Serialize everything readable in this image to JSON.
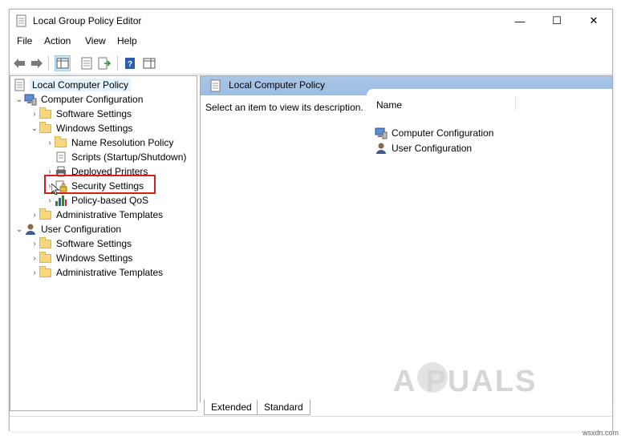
{
  "window": {
    "title": "Local Group Policy Editor",
    "controls": {
      "minimize": "—",
      "maximize": "☐",
      "close": "✕"
    }
  },
  "menu": {
    "items": [
      "File",
      "Action",
      "View",
      "Help"
    ]
  },
  "toolbar": {
    "buttons": [
      "back-arrow-icon",
      "forward-arrow-icon",
      "show-hide-tree-icon",
      "properties-icon",
      "export-list-icon",
      "help-icon",
      "show-hide-action-pane-icon"
    ]
  },
  "tree": {
    "root": "Local Computer Policy",
    "computer_config": "Computer Configuration",
    "cc_software": "Software Settings",
    "cc_windows": "Windows Settings",
    "name_resolution": "Name Resolution Policy",
    "scripts": "Scripts (Startup/Shutdown)",
    "deployed_printers": "Deployed Printers",
    "security_settings": "Security Settings",
    "policy_qos": "Policy-based QoS",
    "cc_admin": "Administrative Templates",
    "user_config": "User Configuration",
    "uc_software": "Software Settings",
    "uc_windows": "Windows Settings",
    "uc_admin": "Administrative Templates"
  },
  "right_pane": {
    "header_title": "Local Computer Policy",
    "description": "Select an item to view its description.",
    "column_name": "Name",
    "items": [
      "Computer Configuration",
      "User Configuration"
    ]
  },
  "tabs": {
    "extended": "Extended",
    "standard": "Standard"
  },
  "watermark": {
    "text": "A PUALS",
    "site": "wsxdn.com"
  },
  "colors": {
    "highlight_border": "#d02020",
    "header_blue": "#a9c5e6",
    "folder": "#f6d77c"
  }
}
